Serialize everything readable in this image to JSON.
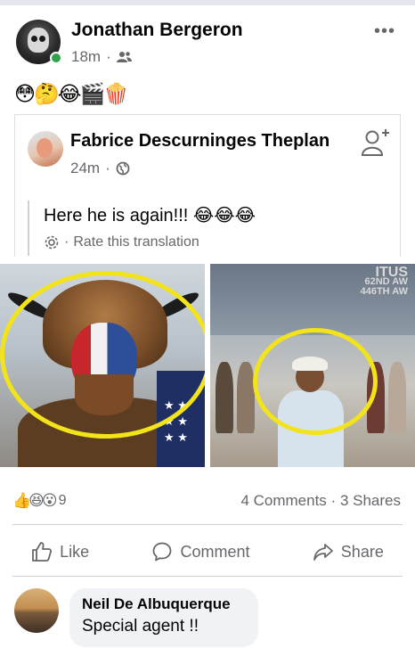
{
  "post": {
    "author": "Jonathan Bergeron",
    "time": "18m",
    "separator": "·",
    "emoji_line": "😳🤔😂🎬🍿"
  },
  "shared_post": {
    "author": "Fabrice Descurninges Theplan",
    "time": "24m",
    "separator": "·",
    "text": "Here he is again!!!",
    "text_emojis": "😂😂😂",
    "translation_separator": "·",
    "translation_link": "Rate this translation"
  },
  "photo_right": {
    "tail_lines": [
      "ITUS",
      "62ND AW",
      "446TH AW"
    ]
  },
  "reactions": {
    "icons": "👍😆😮",
    "count": "9",
    "comments": "4 Comments",
    "separator": "·",
    "shares": "3 Shares"
  },
  "actions": {
    "like": "Like",
    "comment": "Comment",
    "share": "Share"
  },
  "comment": {
    "author": "Neil De Albuquerque",
    "text": "Special agent !!"
  },
  "colors": {
    "secondary_text": "#65676b",
    "online": "#31a24c",
    "highlight_circle": "#f2e31b",
    "bubble": "#f0f2f5"
  }
}
